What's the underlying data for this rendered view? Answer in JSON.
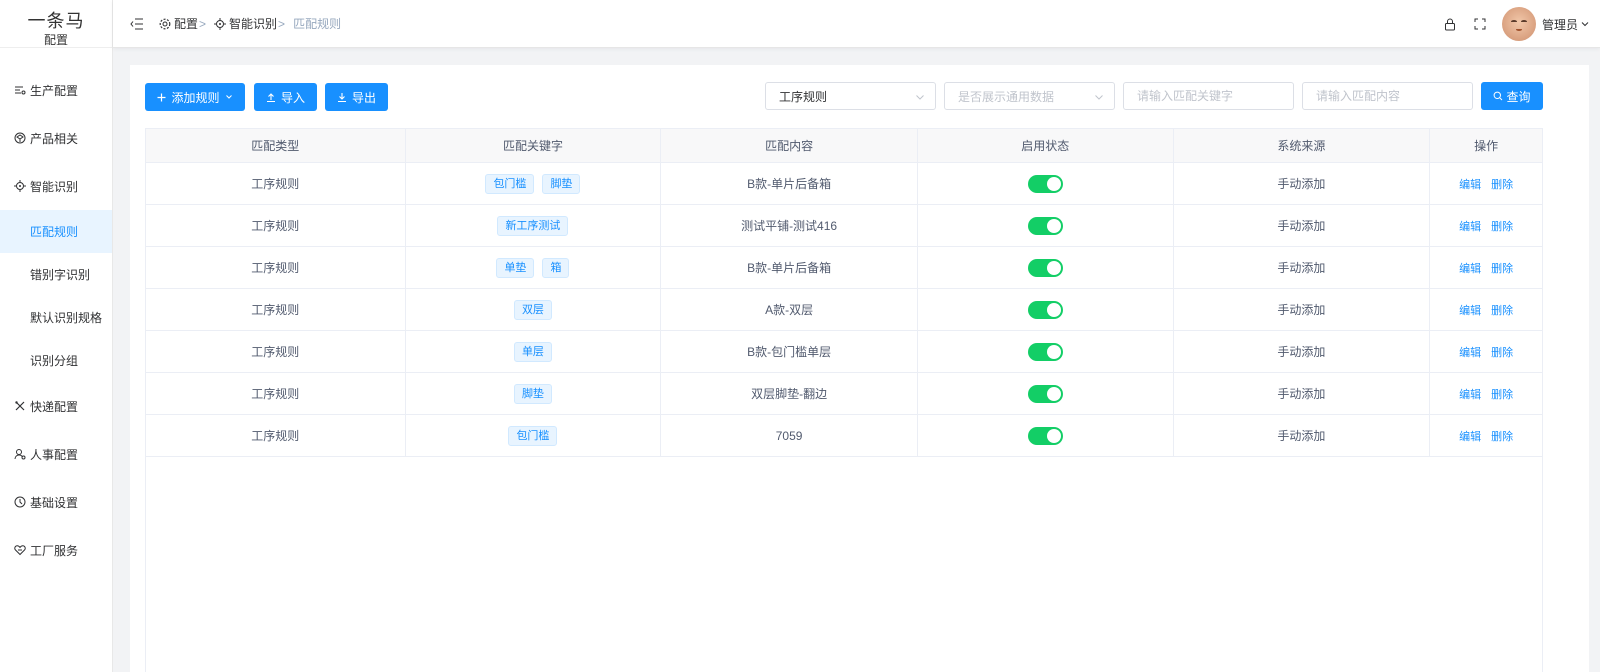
{
  "logo": {
    "title": "一条马",
    "subtitle": "配置"
  },
  "sidebar": {
    "items": [
      {
        "label": "生产配置",
        "icon": "sliders-icon"
      },
      {
        "label": "产品相关",
        "icon": "product-icon"
      },
      {
        "label": "智能识别",
        "icon": "target-icon"
      },
      {
        "label": "快递配置",
        "icon": "tools-icon"
      },
      {
        "label": "人事配置",
        "icon": "user-icon"
      },
      {
        "label": "基础设置",
        "icon": "settings-icon"
      },
      {
        "label": "工厂服务",
        "icon": "heart-icon"
      }
    ],
    "subitems": [
      "匹配规则",
      "错别字识别",
      "默认识别规格",
      "识别分组"
    ]
  },
  "breadcrumb": {
    "items": [
      "配置",
      "智能识别",
      "匹配规则"
    ],
    "separator": ">"
  },
  "header": {
    "user": "管理员"
  },
  "toolbar": {
    "add_label": "添加规则",
    "import_label": "导入",
    "export_label": "导出",
    "rule_type_value": "工序规则",
    "general_placeholder": "是否展示通用数据",
    "keyword_placeholder": "请输入匹配关键字",
    "content_placeholder": "请输入匹配内容",
    "query_label": "查询"
  },
  "table": {
    "columns": [
      "匹配类型",
      "匹配关键字",
      "匹配内容",
      "启用状态",
      "系统来源",
      "操作"
    ],
    "actions": {
      "edit": "编辑",
      "delete": "删除"
    },
    "rows": [
      {
        "type": "工序规则",
        "keywords": [
          "包门槛",
          "脚垫"
        ],
        "content": "B款-单片后备箱",
        "enabled": true,
        "source": "手动添加"
      },
      {
        "type": "工序规则",
        "keywords": [
          "新工序测试"
        ],
        "content": "测试平铺-测试416",
        "enabled": true,
        "source": "手动添加"
      },
      {
        "type": "工序规则",
        "keywords": [
          "单垫",
          "箱"
        ],
        "content": "B款-单片后备箱",
        "enabled": true,
        "source": "手动添加"
      },
      {
        "type": "工序规则",
        "keywords": [
          "双层"
        ],
        "content": "A款-双层",
        "enabled": true,
        "source": "手动添加"
      },
      {
        "type": "工序规则",
        "keywords": [
          "单层"
        ],
        "content": "B款-包门槛单层",
        "enabled": true,
        "source": "手动添加"
      },
      {
        "type": "工序规则",
        "keywords": [
          "脚垫"
        ],
        "content": "双层脚垫-翻边",
        "enabled": true,
        "source": "手动添加"
      },
      {
        "type": "工序规则",
        "keywords": [
          "包门槛"
        ],
        "content": "7059",
        "enabled": true,
        "source": "手动添加"
      }
    ]
  },
  "colors": {
    "primary": "#1890ff",
    "switch_on": "#13ce66",
    "active_bg": "#e8f4ff"
  }
}
